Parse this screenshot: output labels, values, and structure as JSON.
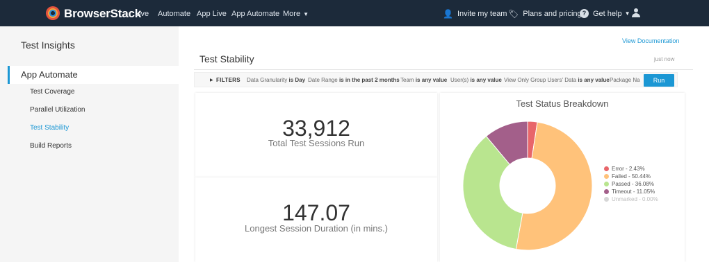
{
  "nav": {
    "brand": "BrowserStack",
    "links": [
      "Live",
      "Automate",
      "App Live",
      "App Automate",
      "More"
    ],
    "invite": "Invite my team",
    "plans": "Plans and pricing",
    "help": "Get help"
  },
  "sidebar": {
    "title": "Test Insights",
    "section": "App Automate",
    "items": [
      "Test Coverage",
      "Parallel Utilization",
      "Test Stability",
      "Build Reports"
    ]
  },
  "main": {
    "view_doc": "View Documentation",
    "title": "Test Stability",
    "updated": "just now",
    "filters_label": "FILTERS",
    "filters": [
      {
        "name": "Data Granularity",
        "op": "is",
        "value": "Day"
      },
      {
        "name": "Date Range",
        "op": "is in the past",
        "value": "2 months"
      },
      {
        "name": "Team",
        "op": "is",
        "value": "any value"
      },
      {
        "name": "User(s)",
        "op": "is",
        "value": "any value"
      },
      {
        "name": "View Only Group Users' Data",
        "op": "is",
        "value": "any value"
      },
      {
        "name": "Package Na",
        "op": "",
        "value": ""
      }
    ],
    "run_label": "Run"
  },
  "kpis": [
    {
      "value": "33,912",
      "label": "Total Test Sessions Run"
    },
    {
      "value": "147.07",
      "label": "Longest Session Duration (in mins.)"
    }
  ],
  "chart_data": {
    "type": "pie",
    "title": "Test Status Breakdown",
    "categories": [
      "Error",
      "Failed",
      "Passed",
      "Timeout",
      "Unmarked"
    ],
    "values": [
      2.43,
      50.44,
      36.08,
      11.05,
      0.0
    ],
    "legend": [
      "Error - 2.43%",
      "Failed - 50.44%",
      "Passed - 36.08%",
      "Timeout - 11.05%",
      "Unmarked - 0.00%"
    ],
    "colors": [
      "#e8666a",
      "#ffc27a",
      "#b9e58f",
      "#a35f8a",
      "#d6d6d6"
    ],
    "donut": true,
    "legend_position": "right"
  }
}
